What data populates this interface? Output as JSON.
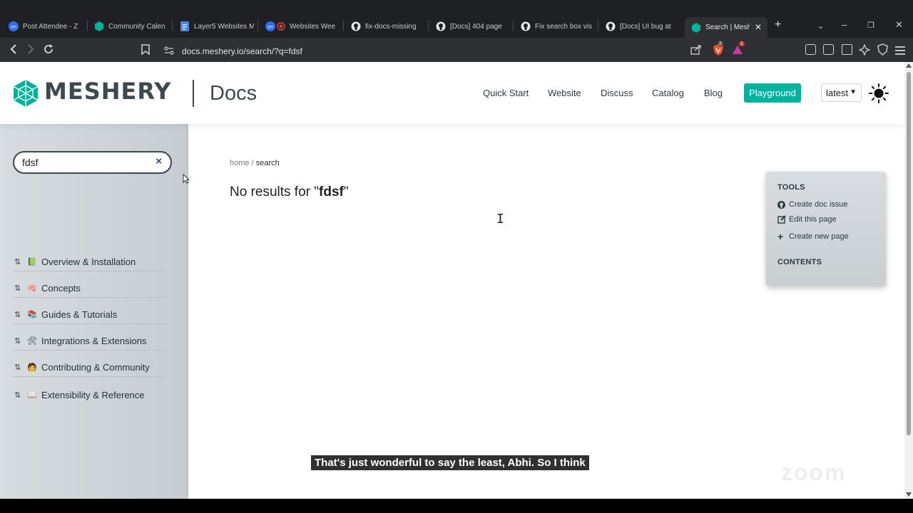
{
  "browser": {
    "tabs": [
      {
        "title": "Post Attendee - Z",
        "icon": "zoom-icon"
      },
      {
        "title": "Community Calen",
        "icon": "meshery-icon"
      },
      {
        "title": "Layer5 Websites M",
        "icon": "google-docs-icon"
      },
      {
        "title": "Websites Wee",
        "icon": "zoom-recording-icon"
      },
      {
        "title": "fix-docs-missing",
        "icon": "github-icon"
      },
      {
        "title": "[Docs] 404 page",
        "icon": "github-icon"
      },
      {
        "title": "Fix search box vis",
        "icon": "github-icon"
      },
      {
        "title": "[Docs] UI bug at",
        "icon": "github-icon"
      },
      {
        "title": "Search | Mesh",
        "icon": "meshery-icon"
      }
    ],
    "url": "docs.meshery.io/search/?q=fdsf",
    "brave_badge": "2",
    "alert_badge": "1"
  },
  "header": {
    "logo_text": "MESHERY",
    "docs_label": "Docs",
    "nav": [
      "Quick Start",
      "Website",
      "Discuss",
      "Catalog",
      "Blog"
    ],
    "playground_label": "Playground",
    "version": "latest"
  },
  "sidebar": {
    "search_value": "fdsf",
    "clear_label": "×",
    "items": [
      {
        "label": "Overview & Installation",
        "emoji": "📗"
      },
      {
        "label": "Concepts",
        "emoji": "🧠"
      },
      {
        "label": "Guides & Tutorials",
        "emoji": "📚"
      },
      {
        "label": "Integrations & Extensions",
        "emoji": "🛠"
      },
      {
        "label": "Contributing & Community",
        "emoji": "🧑"
      },
      {
        "label": "Extensibility & Reference",
        "emoji": "📖"
      }
    ]
  },
  "main": {
    "breadcrumb_home": "home",
    "breadcrumb_sep": "/",
    "breadcrumb_current": "search",
    "no_results_prefix": "No results for \"",
    "query": "fdsf",
    "no_results_suffix": "\""
  },
  "tools": {
    "heading": "TOOLS",
    "links": [
      "Create doc issue",
      "Edit this page",
      "Create new page"
    ],
    "contents_heading": "CONTENTS"
  },
  "overlay": {
    "caption": "That's just wonderful to say the least, Abhi. So I think",
    "watermark": "zoom"
  },
  "colors": {
    "accent": "#00b39f",
    "logo": "#3c494f",
    "chrome_dark": "#1f2023"
  }
}
